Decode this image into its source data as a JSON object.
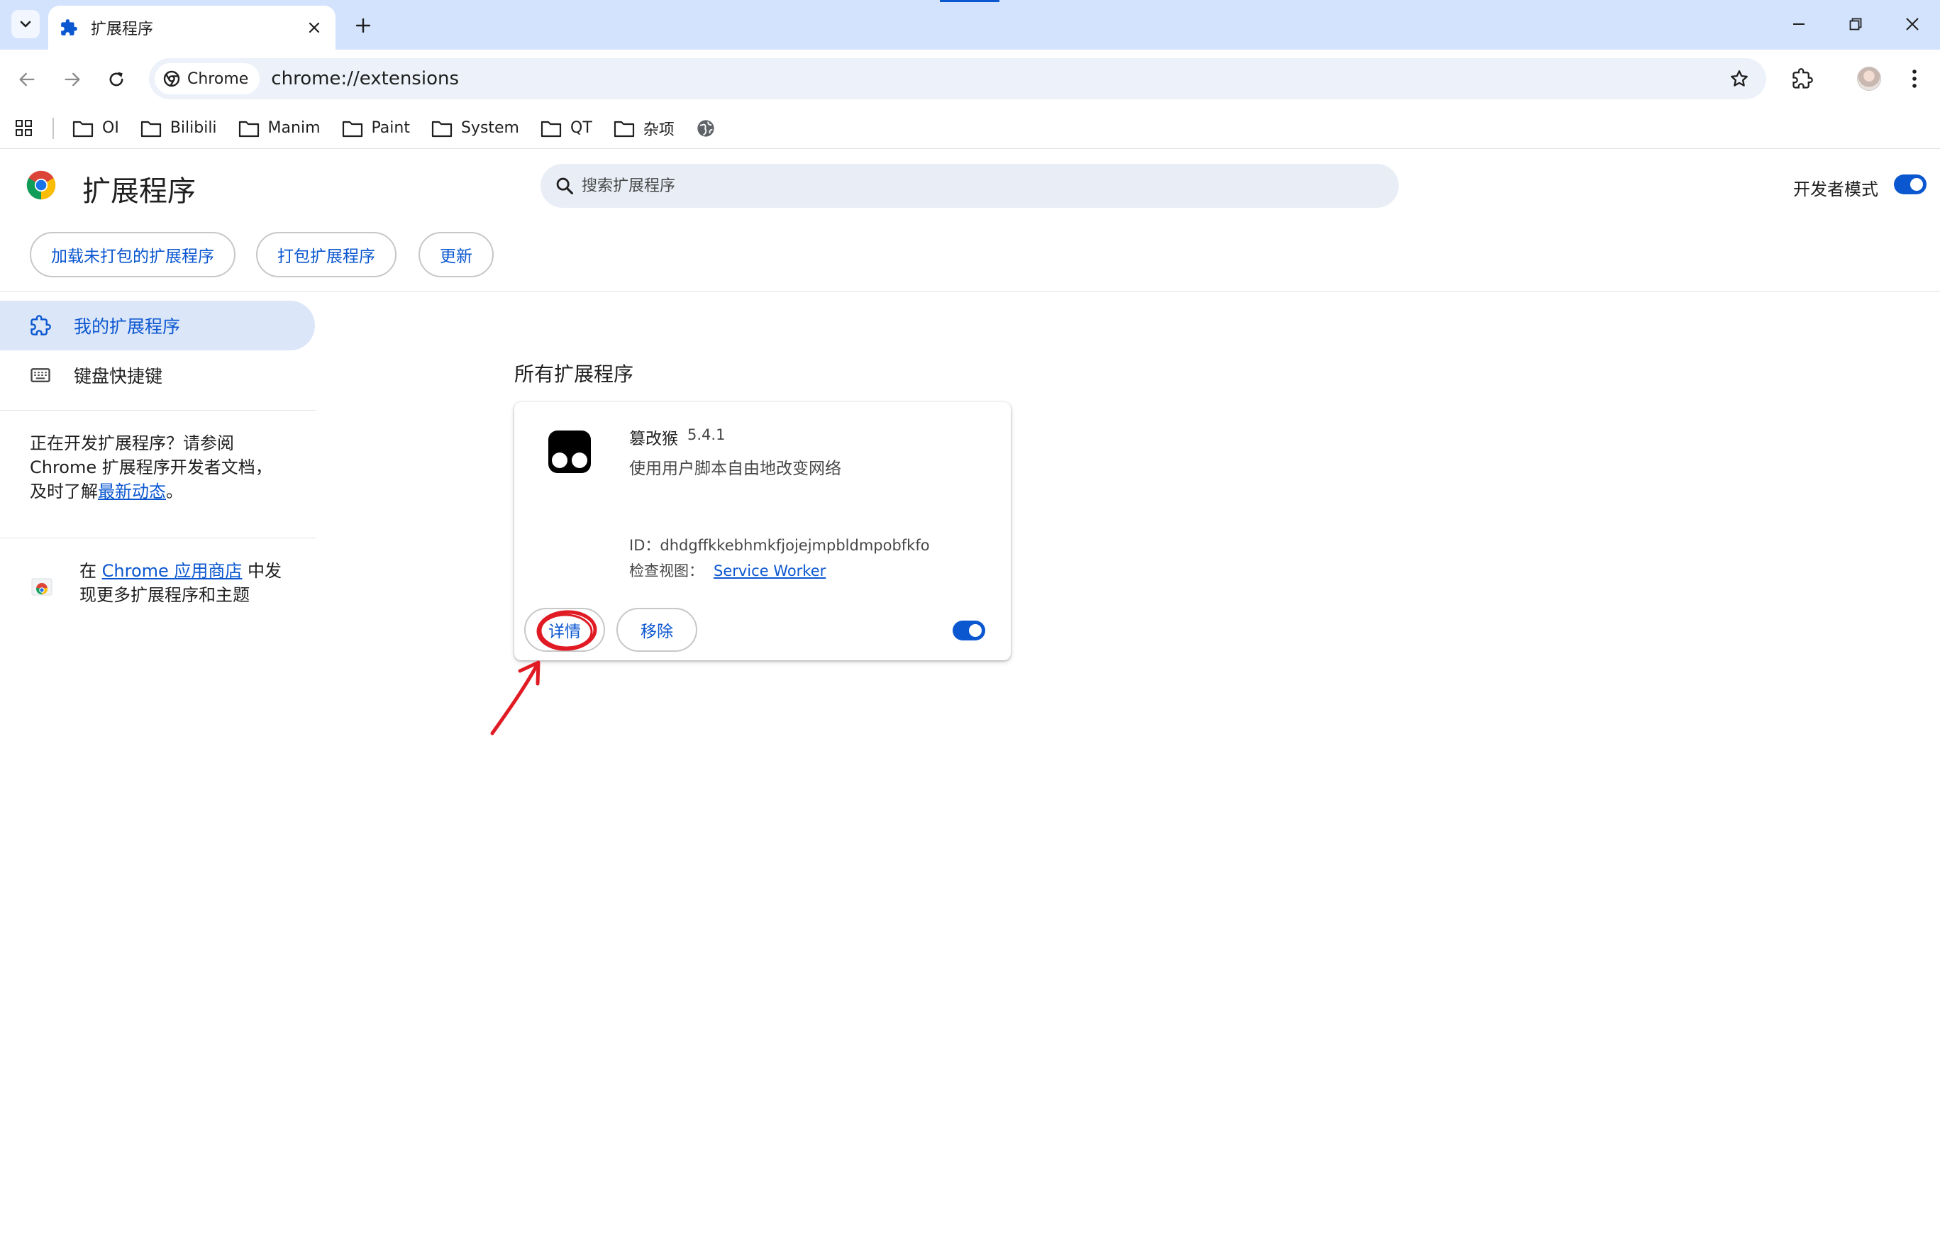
{
  "tabstrip": {
    "tab_title": "扩展程序",
    "colors": {
      "background": "#d3e3fd",
      "accent": "#0b57d0"
    }
  },
  "toolbar": {
    "chip_label": "Chrome",
    "url": "chrome://extensions"
  },
  "bookmarks": [
    {
      "label": "OI"
    },
    {
      "label": "Bilibili"
    },
    {
      "label": "Manim"
    },
    {
      "label": "Paint"
    },
    {
      "label": "System"
    },
    {
      "label": "QT"
    },
    {
      "label": "杂项"
    }
  ],
  "header": {
    "title": "扩展程序",
    "search_placeholder": "搜索扩展程序",
    "dev_mode_label": "开发者模式",
    "dev_mode_on": true,
    "buttons": {
      "load_unpacked": "加载未打包的扩展程序",
      "pack": "打包扩展程序",
      "update": "更新"
    }
  },
  "sidebar": {
    "items": [
      {
        "label": "我的扩展程序",
        "icon": "extension-icon",
        "active": true
      },
      {
        "label": "键盘快捷键",
        "icon": "keyboard-icon",
        "active": false
      }
    ],
    "dev_note": {
      "line1": "正在开发扩展程序？请参阅",
      "line2": "Chrome 扩展程序开发者文档，",
      "line3_prefix": "及时了解",
      "link": "最新动态",
      "line3_suffix": "。"
    },
    "webstore": {
      "prefix": "在 ",
      "link": "Chrome 应用商店",
      "suffix": " 中发",
      "line2": "现更多扩展程序和主题"
    }
  },
  "main": {
    "section_title": "所有扩展程序",
    "extensions": [
      {
        "name": "篡改猴",
        "version": "5.4.1",
        "description": "使用用户脚本自由地改变网络",
        "id_text": "ID：dhdgffkkebhmkfjojejmpbldmpobfkfo",
        "inspect_label": "检查视图：",
        "inspect_link": "Service Worker",
        "details_label": "详情",
        "remove_label": "移除",
        "enabled": true
      }
    ]
  },
  "annotation": {
    "color": "#e01b24"
  }
}
